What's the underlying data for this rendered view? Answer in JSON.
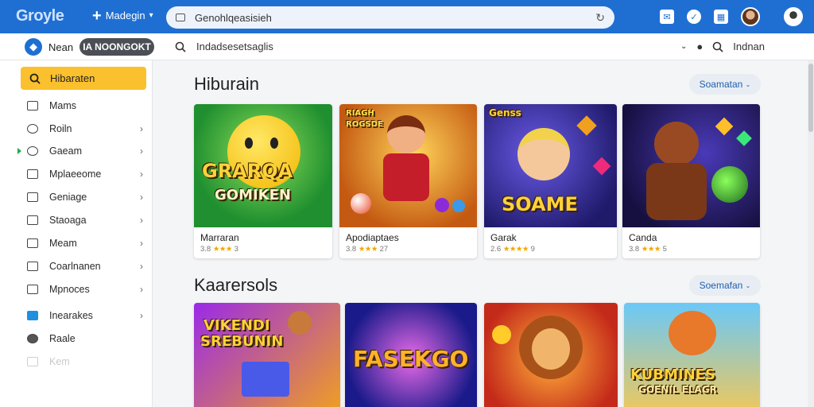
{
  "browser": {
    "logo": "Groyle",
    "new_tab_label": "Madegin",
    "url": "Genohlqeasisieh",
    "icons": [
      "mail-icon",
      "shield-icon",
      "bookmark-icon"
    ]
  },
  "secondary_bar": {
    "brand_name": "Nean",
    "brand_pill": "IA NOONGOKT",
    "search_text": "Indadsesetsaglis",
    "right_label": "Indnan"
  },
  "sidebar": {
    "active": {
      "label": "Hibaraten",
      "icon": "search-icon"
    },
    "items": [
      {
        "label": "Mams",
        "icon": "list-icon",
        "chevron": false
      },
      {
        "label": "Roiln",
        "icon": "circle-icon",
        "chevron": true
      },
      {
        "label": "Gaeam",
        "icon": "globe-icon",
        "chevron": true
      },
      {
        "label": "Mplaeeome",
        "icon": "window-icon",
        "chevron": true
      },
      {
        "label": "Geniage",
        "icon": "folder-icon",
        "chevron": true
      },
      {
        "label": "Staoaga",
        "icon": "bag-icon",
        "chevron": true
      },
      {
        "label": "Meam",
        "icon": "grid-icon",
        "chevron": true
      },
      {
        "label": "Coarlnanen",
        "icon": "bag-icon",
        "chevron": true
      },
      {
        "label": "Mpnoces",
        "icon": "building-icon",
        "chevron": true
      },
      {
        "label": "Inearakes",
        "icon": "briefcase-icon",
        "chevron": true
      },
      {
        "label": "Raale",
        "icon": "circle-icon",
        "chevron": false
      },
      {
        "label": "Kem",
        "icon": "tag-icon",
        "chevron": false
      }
    ]
  },
  "sections": [
    {
      "title": "Hiburain",
      "see_all": "Soamatan",
      "cards": [
        {
          "title": "Marraran",
          "rating": "3.8",
          "stars": "★★★",
          "count": "3",
          "art_text": [
            "GRARQA",
            "GOMIKEN"
          ]
        },
        {
          "title": "Apodiaptaes",
          "rating": "3.8",
          "stars": "★★★",
          "count": "27",
          "art_text": [
            "RIAGH",
            "ROGSDE"
          ]
        },
        {
          "title": "Garak",
          "rating": "2.6",
          "stars": "★★★★",
          "count": "9",
          "art_text": [
            "Genss",
            "SOAME"
          ]
        },
        {
          "title": "Canda",
          "rating": "3.8",
          "stars": "★★★",
          "count": "5",
          "art_text": []
        }
      ]
    },
    {
      "title": "Kaarersols",
      "see_all": "Soemafan",
      "cards": [
        {
          "art_text": [
            "VIKENDI",
            "SREBUNIN"
          ]
        },
        {
          "art_text": [
            "FASEKGO"
          ]
        },
        {
          "art_text": []
        },
        {
          "art_text": [
            "KUBMINES",
            "GOENIL ELAGR"
          ]
        }
      ]
    }
  ],
  "colors": {
    "browser_bar": "#1f6fd3",
    "active_item": "#fbc02d",
    "see_all_text": "#1f5fb0",
    "star": "#f2a600"
  }
}
